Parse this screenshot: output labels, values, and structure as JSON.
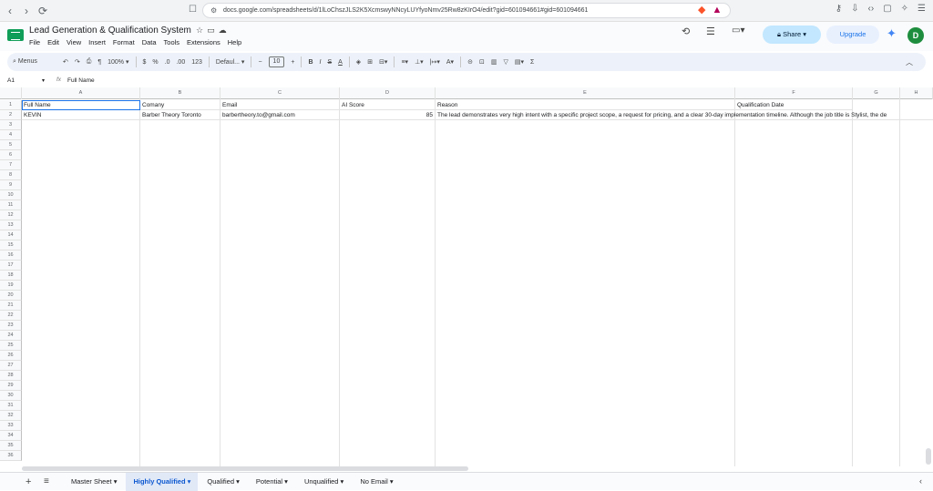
{
  "browser": {
    "url": "docs.google.com/spreadsheets/d/1lLoChszJLS2K5XcmswyNNcyLUYfyoNmv25Rw8zKIrO4/edit?gid=601094661#gid=601094661",
    "back_icon": "‹",
    "forward_icon": "›",
    "reload_icon": "⟳"
  },
  "app": {
    "title": "Lead Generation & Qualification System",
    "menu": [
      "File",
      "Edit",
      "View",
      "Insert",
      "Format",
      "Data",
      "Tools",
      "Extensions",
      "Help"
    ],
    "share_label": "Share",
    "upgrade_label": "Upgrade",
    "avatar_initial": "D",
    "accent": "#0f9d58"
  },
  "toolbar": {
    "menus_label": "Menus",
    "zoom": "100%",
    "currency": "$",
    "percent": "%",
    "dec_decrease": ".0",
    "dec_increase": ".00",
    "format_123": "123",
    "font": "Defaul...",
    "font_size": "10"
  },
  "formula_bar": {
    "cell_ref": "A1",
    "content": "Full Name"
  },
  "grid": {
    "columns": [
      "A",
      "B",
      "C",
      "D",
      "E",
      "F",
      "G",
      "H"
    ],
    "header_row": [
      "Full Name",
      "Comany",
      "Email",
      "AI Score",
      "Reason",
      "",
      "Qualification Date",
      "",
      ""
    ],
    "row2": {
      "full_name": "KEVIN",
      "company": "Barber Theory Toronto",
      "email": "barbertheory.to@gmail.com",
      "ai_score": "85",
      "reason": "The lead demonstrates very high intent with a specific project scope, a request for pricing, and a clear 30-day implementation timeline. Although the job title is Stylist, the de"
    },
    "row_numbers": [
      "1",
      "2",
      "3",
      "4",
      "5",
      "6",
      "7",
      "8",
      "9",
      "10",
      "11",
      "12",
      "13",
      "14",
      "15",
      "16",
      "17",
      "18",
      "19",
      "20",
      "21",
      "22",
      "23",
      "24",
      "25",
      "26",
      "27",
      "28",
      "29",
      "30",
      "31",
      "32",
      "33",
      "34",
      "35",
      "36"
    ]
  },
  "sheets": {
    "tabs": [
      "Master Sheet",
      "Highly Qualified",
      "Qualified",
      "Potential",
      "Unqualified",
      "No Email"
    ],
    "active": "Highly Qualified"
  }
}
